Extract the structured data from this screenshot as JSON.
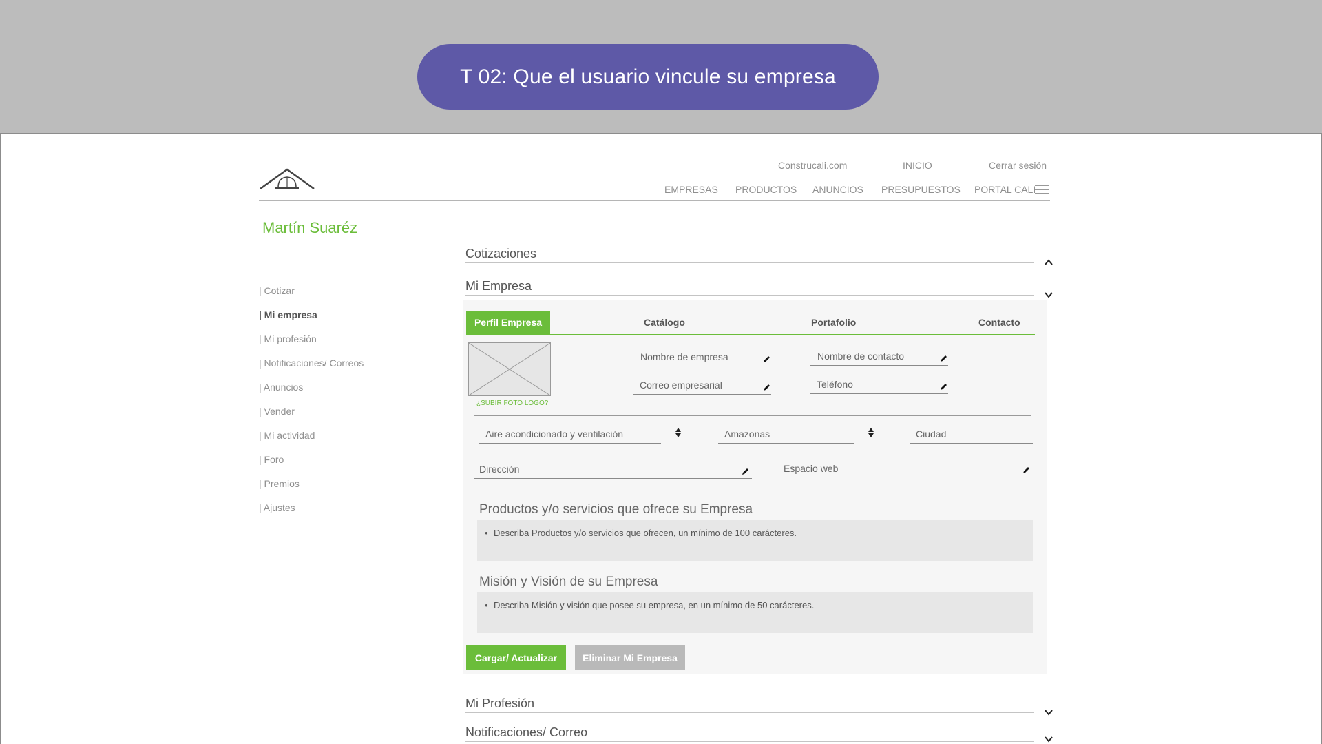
{
  "task": {
    "title": "T 02: Que el usuario vincule su empresa"
  },
  "header": {
    "top_links": {
      "site": "Construcali.com",
      "home": "INICIO",
      "logout": "Cerrar sesión"
    },
    "nav": [
      "EMPRESAS",
      "PRODUCTOS",
      "ANUNCIOS",
      "PRESUPUESTOS",
      "PORTAL CALI"
    ]
  },
  "user": {
    "name": "Martín Suaréz"
  },
  "sidebar": {
    "items": [
      {
        "label": "| Cotizar"
      },
      {
        "label": "| Mi empresa"
      },
      {
        "label": "| Mi profesión"
      },
      {
        "label": "| Notificaciones/ Correos"
      },
      {
        "label": "| Anuncios"
      },
      {
        "label": "| Vender"
      },
      {
        "label": "| Mi actividad"
      },
      {
        "label": "| Foro"
      },
      {
        "label": "| Premios"
      },
      {
        "label": "| Ajustes"
      }
    ],
    "active": "| Mi empresa"
  },
  "sections": {
    "cotizaciones": "Cotizaciones",
    "mi_empresa": "Mi Empresa",
    "mi_profesion": "Mi Profesión",
    "notificaciones": "Notificaciones/ Correo"
  },
  "tabs": [
    "Perfil Empresa",
    "Catálogo",
    "Portafolio",
    "Contacto"
  ],
  "form": {
    "upload_logo": "¿SUBIR FOTO LOGO?",
    "company_name": "Nombre de empresa",
    "contact_name": "Nombre de contacto",
    "company_email": "Correo empresarial",
    "phone": "Teléfono",
    "category": "Aire acondicionado y ventilación",
    "department": "Amazonas",
    "city": "Ciudad",
    "address": "Dirección",
    "website": "Espacio web",
    "products_title": "Productos y/o servicios que ofrece su Empresa",
    "products_hint": "Describa Productos y/o servicios que ofrecen, un mínimo  de 100 carácteres.",
    "mission_title": "Misión y Visión de su Empresa",
    "mission_hint": "Describa Misión y visión que posee su empresa, en un mínimo  de 50 carácteres."
  },
  "buttons": {
    "save": "Cargar/ Actualizar",
    "delete": "Eliminar Mi Empresa"
  },
  "colors": {
    "accent": "#6bbd3a",
    "task_pill": "#5e59a7",
    "background": "#bcbcbc"
  }
}
